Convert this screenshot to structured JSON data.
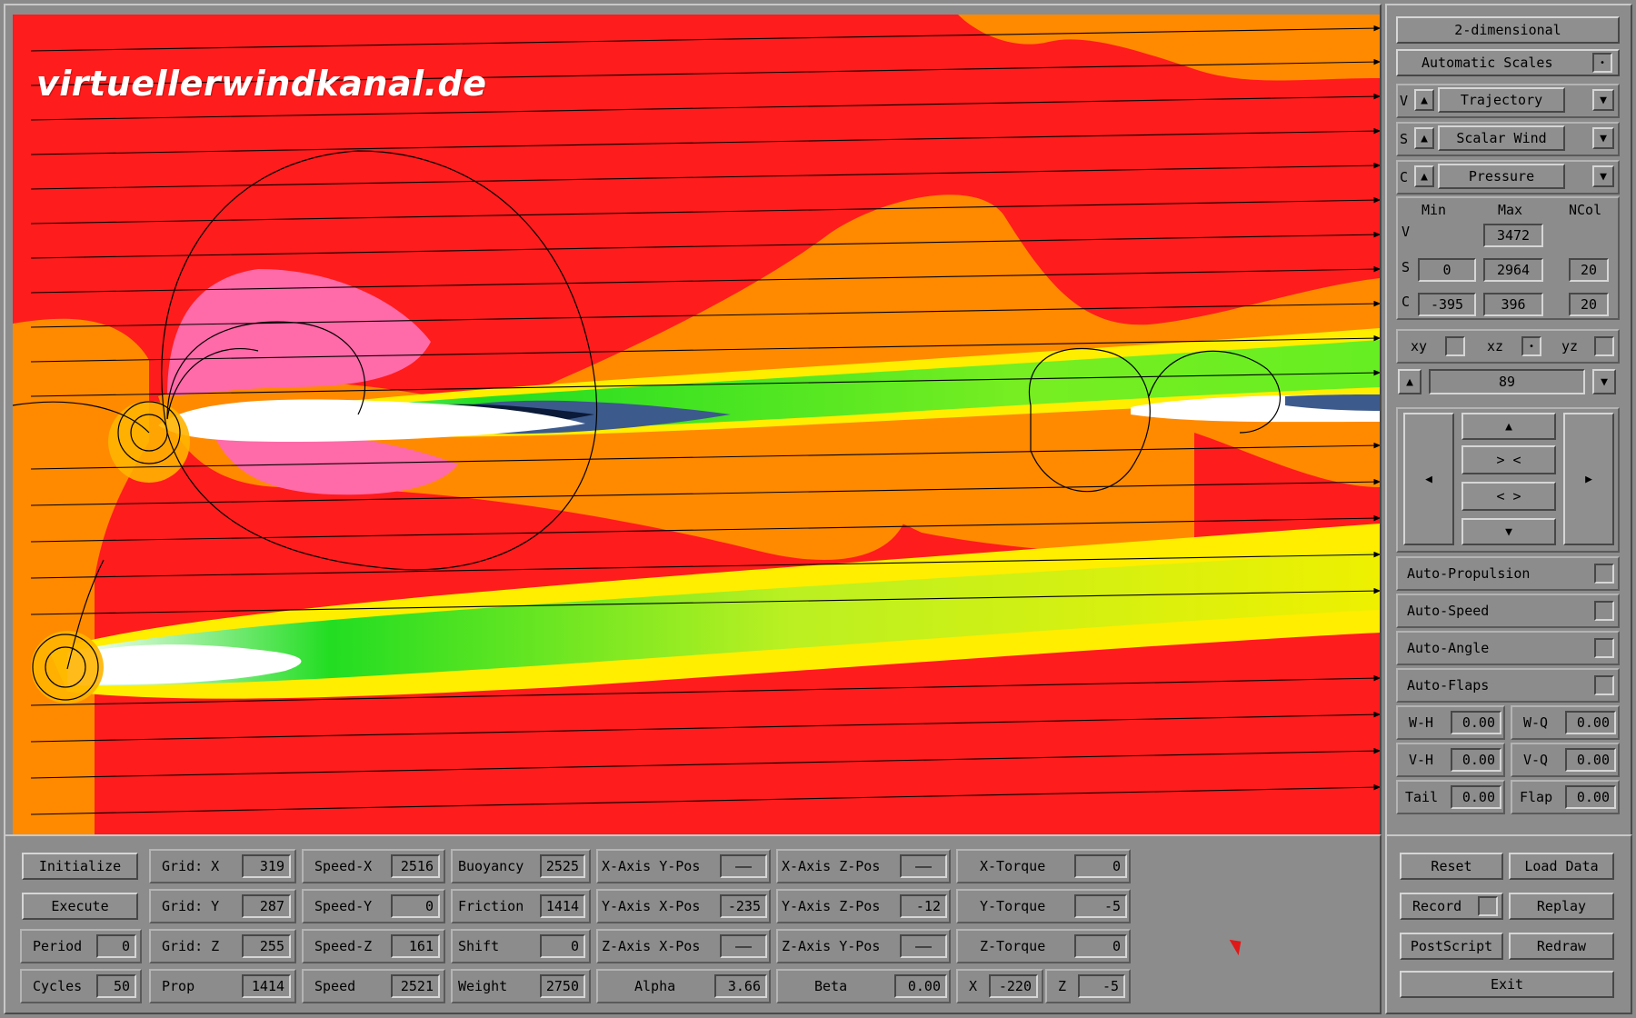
{
  "viz": {
    "watermark": "virtuellerwindkanal.de"
  },
  "side": {
    "dimension_button": "2-dimensional",
    "auto_scales": {
      "label": "Automatic Scales",
      "checked": true
    },
    "selectors": [
      {
        "key": "V",
        "value": "Trajectory"
      },
      {
        "key": "S",
        "value": "Scalar Wind"
      },
      {
        "key": "C",
        "value": "Pressure"
      }
    ],
    "range_headers": {
      "min": "Min",
      "max": "Max",
      "ncol": "NCol"
    },
    "ranges": {
      "V": {
        "label": "V",
        "max": "3472"
      },
      "S": {
        "label": "S",
        "min": "0",
        "max": "2964",
        "ncol": "20"
      },
      "C": {
        "label": "C",
        "min": "-395",
        "max": "396",
        "ncol": "20"
      }
    },
    "planes": [
      {
        "label": "xy",
        "checked": false
      },
      {
        "label": "xz",
        "checked": true
      },
      {
        "label": "yz",
        "checked": false
      }
    ],
    "slice_value": "89",
    "nav": {
      "up": "▲",
      "zoom_in": "> <",
      "zoom_out": "< >",
      "down": "▼",
      "left": "◀",
      "right": "▶"
    },
    "autos": [
      {
        "label": "Auto-Propulsion",
        "checked": false
      },
      {
        "label": "Auto-Speed",
        "checked": false
      },
      {
        "label": "Auto-Angle",
        "checked": false
      },
      {
        "label": "Auto-Flaps",
        "checked": false
      }
    ],
    "params": [
      {
        "label": "W-H",
        "value": "0.00"
      },
      {
        "label": "W-Q",
        "value": "0.00"
      },
      {
        "label": "V-H",
        "value": "0.00"
      },
      {
        "label": "V-Q",
        "value": "0.00"
      },
      {
        "label": "Tail",
        "value": "0.00"
      },
      {
        "label": "Flap",
        "value": "0.00"
      }
    ]
  },
  "bottom": {
    "buttons": {
      "initialize": "Initialize",
      "execute": "Execute"
    },
    "period": {
      "label": "Period",
      "value": "0"
    },
    "cycles": {
      "label": "Cycles",
      "value": "50"
    },
    "grid_x": {
      "label": "Grid: X",
      "value": "319"
    },
    "grid_y": {
      "label": "Grid: Y",
      "value": "287"
    },
    "grid_z": {
      "label": "Grid: Z",
      "value": "255"
    },
    "prop": {
      "label": "Prop",
      "value": "1414"
    },
    "speed_x": {
      "label": "Speed-X",
      "value": "2516"
    },
    "speed_y": {
      "label": "Speed-Y",
      "value": "0"
    },
    "speed_z": {
      "label": "Speed-Z",
      "value": "161"
    },
    "speed": {
      "label": "Speed",
      "value": "2521"
    },
    "buoyancy": {
      "label": "Buoyancy",
      "value": "2525"
    },
    "friction": {
      "label": "Friction",
      "value": "1414"
    },
    "shift": {
      "label": "Shift",
      "value": "0"
    },
    "weight": {
      "label": "Weight",
      "value": "2750"
    },
    "xaxis_ypos": {
      "label": "X-Axis Y-Pos",
      "value": "——"
    },
    "yaxis_xpos": {
      "label": "Y-Axis X-Pos",
      "value": "-235"
    },
    "zaxis_xpos": {
      "label": "Z-Axis X-Pos",
      "value": "——"
    },
    "alpha": {
      "label": "Alpha",
      "value": "3.66"
    },
    "xaxis_zpos": {
      "label": "X-Axis Z-Pos",
      "value": "——"
    },
    "yaxis_zpos": {
      "label": "Y-Axis Z-Pos",
      "value": "-12"
    },
    "zaxis_ypos": {
      "label": "Z-Axis Y-Pos",
      "value": "——"
    },
    "beta": {
      "label": "Beta",
      "value": "0.00"
    },
    "x_torque": {
      "label": "X-Torque",
      "value": "0"
    },
    "y_torque": {
      "label": "Y-Torque",
      "value": "-5"
    },
    "z_torque": {
      "label": "Z-Torque",
      "value": "0"
    },
    "x_pos": {
      "label": "X",
      "value": "-220"
    },
    "z_pos": {
      "label": "Z",
      "value": "-5"
    }
  },
  "actions": {
    "reset": "Reset",
    "load_data": "Load Data",
    "record": {
      "label": "Record",
      "checked": false
    },
    "replay": "Replay",
    "postscript": "PostScript",
    "redraw": "Redraw",
    "exit": "Exit"
  },
  "colors": {
    "red": "#ff1c1c",
    "orange": "#ff8a00",
    "yellow": "#ffee00",
    "green": "#22dd22",
    "pink": "#ff6aa8",
    "grey_ui": "#8c8c8c"
  }
}
